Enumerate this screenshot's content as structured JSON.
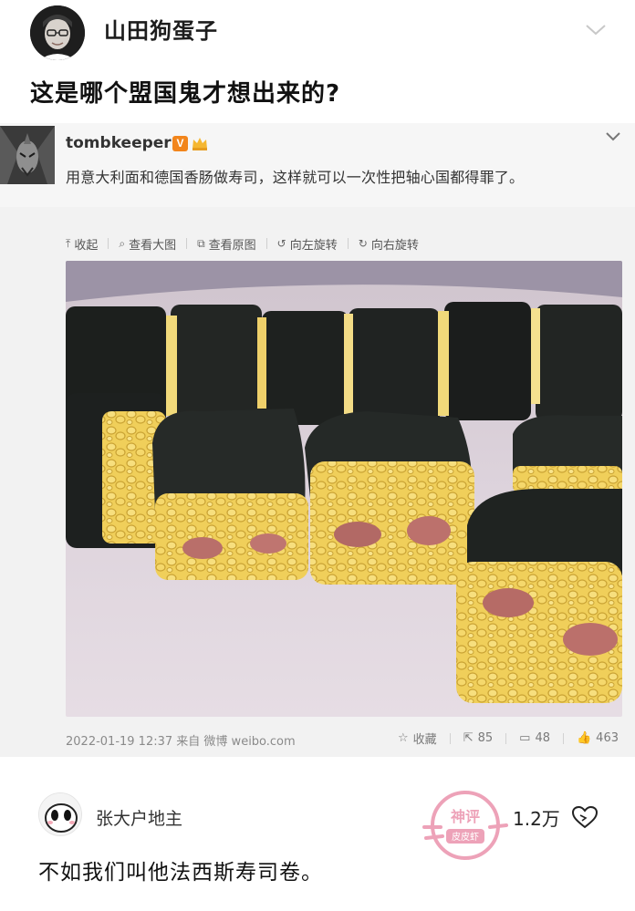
{
  "post": {
    "username": "山田狗蛋子",
    "text": "这是哪个盟国鬼才想出来的?"
  },
  "weibo": {
    "username": "tombkeeper",
    "verified_badge": "V",
    "text": "用意大利面和德国香肠做寿司，这样就可以一次性把轴心国都得罪了。",
    "toolbar": [
      {
        "icon": "collapse-icon",
        "glyph": "⤒",
        "label": "收起"
      },
      {
        "icon": "zoom-icon",
        "glyph": "⌕",
        "label": "查看大图"
      },
      {
        "icon": "external-link-icon",
        "glyph": "⧉",
        "label": "查看原图"
      },
      {
        "icon": "rotate-left-icon",
        "glyph": "↺",
        "label": "向左旋转"
      },
      {
        "icon": "rotate-right-icon",
        "glyph": "↻",
        "label": "向右旋转"
      }
    ],
    "timestamp": "2022-01-19 12:37",
    "source": "来自 微博 weibo.com",
    "actions": {
      "favorite_label": "收藏",
      "repost_count": "85",
      "comment_count": "48",
      "like_count": "463"
    }
  },
  "comment": {
    "username": "张大户地主",
    "like_count": "1.2万",
    "text": "不如我们叫他法西斯寿司卷。"
  },
  "colors": {
    "badge_orange": "#f2851b",
    "card_bg": "#f6f6f6",
    "watermark_pink": "#e0577f"
  }
}
